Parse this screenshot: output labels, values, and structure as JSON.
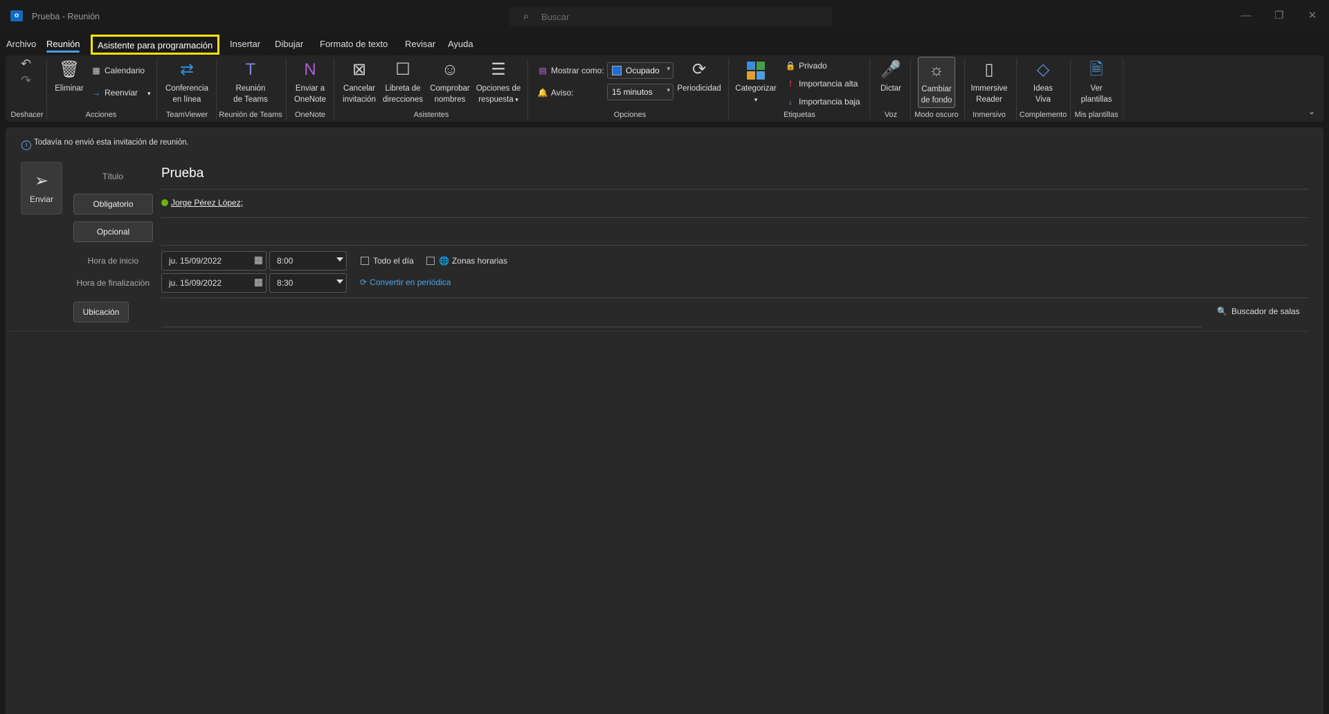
{
  "window": {
    "title": "Prueba  -  Reunión",
    "search_placeholder": "Buscar",
    "minimize": "—",
    "restore": "❐",
    "close": "✕"
  },
  "tabs": [
    {
      "label": "Archivo"
    },
    {
      "label": "Reunión"
    },
    {
      "label": "Asistente para programación"
    },
    {
      "label": "Insertar"
    },
    {
      "label": "Dibujar"
    },
    {
      "label": "Formato de texto"
    },
    {
      "label": "Revisar"
    },
    {
      "label": "Ayuda"
    }
  ],
  "ribbon": {
    "groups": [
      "Deshacer",
      "Acciones",
      "TeamViewer",
      "Reunión de Teams",
      "OneNote",
      "Asistentes",
      "Opciones",
      "Etiquetas",
      "Voz",
      "Modo oscuro",
      "Inmersivo",
      "Complemento",
      "Mis plantillas"
    ],
    "eliminar": "Eliminar",
    "calendario": "Calendario",
    "reenviar": "Reenviar",
    "conferencia": [
      "Conferencia",
      "en línea"
    ],
    "teams": [
      "Reunión",
      "de Teams"
    ],
    "onenote": [
      "Enviar a",
      "OneNote"
    ],
    "cancelar": [
      "Cancelar",
      "invitación"
    ],
    "libreta": [
      "Libreta de",
      "direcciones"
    ],
    "comprobar": [
      "Comprobar",
      "nombres"
    ],
    "respuesta": [
      "Opciones de",
      "respuesta"
    ],
    "mostrar_como": "Mostrar como:",
    "ocupado": "Ocupado",
    "aviso": "Aviso:",
    "minutos": "15 minutos",
    "periodicidad": "Periodicidad",
    "categorizar": "Categorizar",
    "privado": "Privado",
    "alta": "Importancia alta",
    "baja": "Importancia baja",
    "dictar": "Dictar",
    "fondo": [
      "Cambiar",
      "de fondo"
    ],
    "immersive": [
      "Immersive",
      "Reader"
    ],
    "ideas": [
      "Ideas",
      "Viva"
    ],
    "plantillas": [
      "Ver",
      "plantillas"
    ]
  },
  "form": {
    "info": "Todavía no envió esta invitación de reunión.",
    "send": "Enviar",
    "title_label": "Título",
    "title_value": "Prueba",
    "required": "Obligatorio",
    "optional": "Opcional",
    "attendee": "Jorge Pérez López;",
    "start_label": "Hora de inicio",
    "end_label": "Hora de finalización",
    "start_date": "ju. 15/09/2022",
    "start_time": "8:00",
    "end_date": "ju. 15/09/2022",
    "end_time": "8:30",
    "all_day": "Todo el día",
    "time_zones": "Zonas horarias",
    "recurring": "Convertir en periódica",
    "location": "Ubicación",
    "room_finder": "Buscador de salas"
  }
}
